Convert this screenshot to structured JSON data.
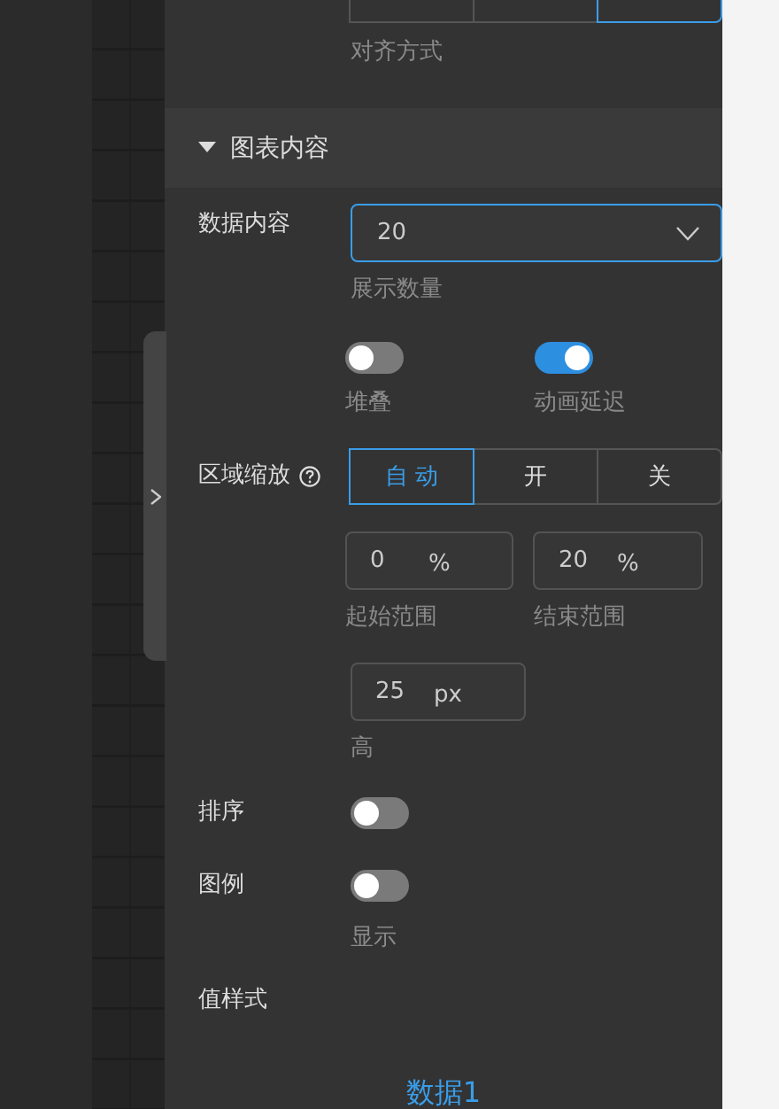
{
  "align": {
    "options": [
      {
        "selected": false
      },
      {
        "selected": false
      },
      {
        "selected": true
      }
    ],
    "caption": "对齐方式"
  },
  "section": {
    "title": "图表内容",
    "expanded": true
  },
  "rows": [
    {
      "kind": "select",
      "label": "数据内容",
      "value": "20",
      "caption": "展示数量"
    },
    {
      "kind": "toggles",
      "items": [
        {
          "caption": "堆叠",
          "on": false
        },
        {
          "caption": "动画延迟",
          "on": true
        }
      ]
    },
    {
      "kind": "segment",
      "label": "区域缩放",
      "options": [
        {
          "label": "自 动",
          "selected": true
        },
        {
          "label": "开",
          "selected": false
        },
        {
          "label": "关",
          "selected": false
        }
      ]
    },
    {
      "kind": "inputs",
      "items": [
        {
          "value": "0",
          "unit": "%",
          "caption": "起始范围"
        },
        {
          "value": "20",
          "unit": "%",
          "caption": "结束范围"
        }
      ]
    },
    {
      "kind": "inputs",
      "items": [
        {
          "value": "25",
          "unit": "px",
          "caption": "高"
        }
      ]
    },
    {
      "kind": "toggle",
      "label": "排序",
      "on": false
    },
    {
      "kind": "toggle",
      "label": "图例",
      "on": false,
      "caption": "显示"
    },
    {
      "kind": "heading",
      "label": "值样式"
    }
  ],
  "tab": {
    "label": "数据1"
  }
}
